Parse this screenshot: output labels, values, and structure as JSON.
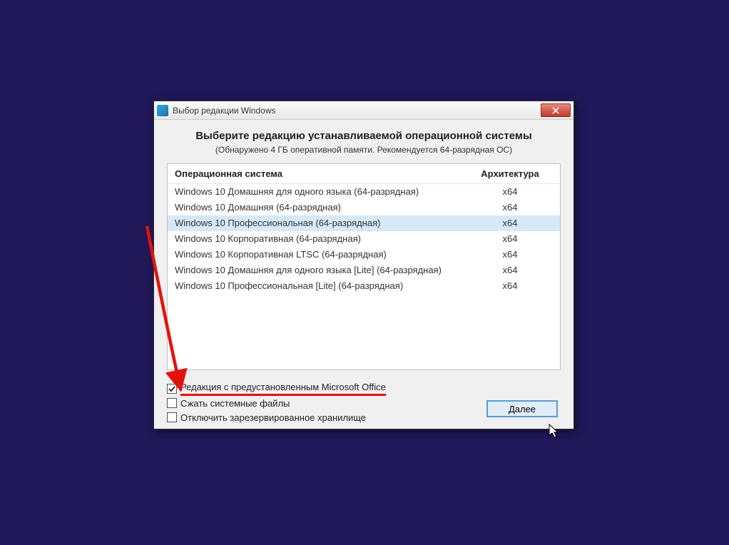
{
  "window": {
    "title": "Выбор редакции Windows",
    "icon": "windows-setup-icon"
  },
  "content": {
    "heading": "Выберите редакцию устанавливаемой операционной системы",
    "subheading": "(Обнаружено 4 ГБ оперативной памяти. Рекомендуется 64-разрядная ОС)"
  },
  "table": {
    "headers": {
      "os": "Операционная система",
      "arch": "Архитектура"
    },
    "rows": [
      {
        "os": "Windows 10 Домашняя для одного языка (64-разрядная)",
        "arch": "x64",
        "selected": false
      },
      {
        "os": "Windows 10 Домашняя (64-разрядная)",
        "arch": "x64",
        "selected": false
      },
      {
        "os": "Windows 10 Профессиональная (64-разрядная)",
        "arch": "x64",
        "selected": true
      },
      {
        "os": "Windows 10 Корпоративная (64-разрядная)",
        "arch": "x64",
        "selected": false
      },
      {
        "os": "Windows 10 Корпоративная LTSC (64-разрядная)",
        "arch": "x64",
        "selected": false
      },
      {
        "os": "Windows 10 Домашняя для одного языка [Lite] (64-разрядная)",
        "arch": "x64",
        "selected": false
      },
      {
        "os": "Windows 10 Профессиональная [Lite] (64-разрядная)",
        "arch": "x64",
        "selected": false
      }
    ]
  },
  "checkboxes": {
    "office": {
      "label": "Редакция с предустановленным Microsoft Office",
      "checked": true,
      "highlight": true
    },
    "compress": {
      "label": "Сжать системные файлы",
      "checked": false,
      "highlight": false
    },
    "disable_reserved": {
      "label": "Отключить зарезервированное хранилище",
      "checked": false,
      "highlight": false
    }
  },
  "buttons": {
    "next": "Далее"
  },
  "annotation": {
    "arrow_color": "#e3120b"
  }
}
